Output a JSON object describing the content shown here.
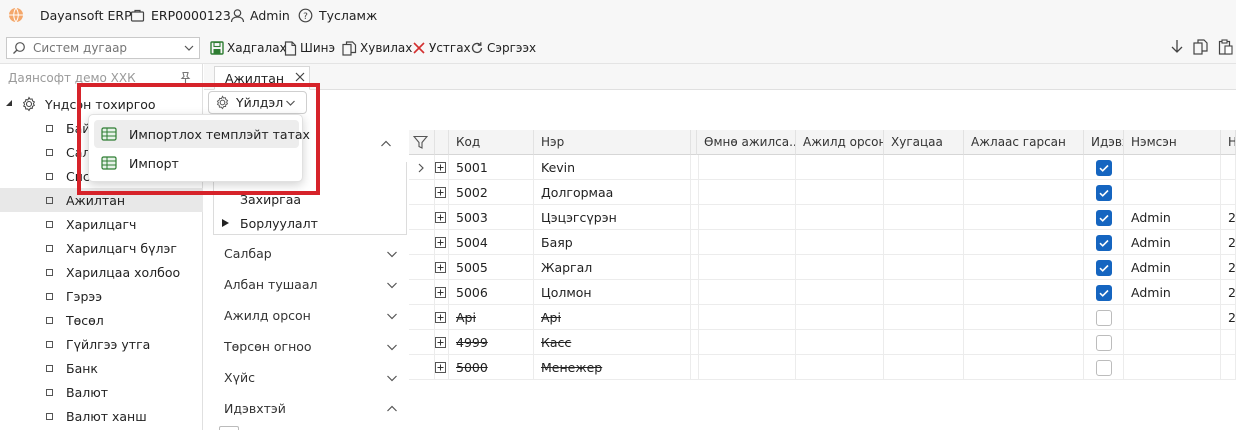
{
  "topbar": {
    "app_name": "Dayansoft ERP",
    "company_code": "ERP0000123",
    "user": "Admin",
    "help": "Тусламж"
  },
  "toolbar": {
    "search_placeholder": "Систем дугаар",
    "save": "Хадгалах",
    "new": "Шинэ",
    "copy": "Хувилах",
    "cancel": "Устгах",
    "refresh": "Сэргээх"
  },
  "left_panel": {
    "company": "Даянсофт демо ХХК",
    "root": "Үндсэн тохиргоо",
    "items": [
      "Байгууллага",
      "Салбар",
      "Систем",
      "Ажилтан",
      "Харилцагч",
      "Харилцагч бүлэг",
      "Харилцаа холбоо",
      "Гэрээ",
      "Төсөл",
      "Гүйлгээ утга",
      "Банк",
      "Валют",
      "Валют ханш"
    ],
    "items_visible": [
      "Байг",
      "Сал",
      "Сист",
      "Ажилтан",
      "Харилцагч",
      "Харилцагч бүлэг",
      "Харилцаа холбоо",
      "Гэрээ",
      "Төсөл",
      "Гүйлгээ утга",
      "Банк",
      "Валют",
      "Валют ханш"
    ],
    "selected_index": 3
  },
  "tabs": [
    {
      "label": "Ажилтан"
    }
  ],
  "actions_button": {
    "label": "Үйлдэл"
  },
  "dropdown_menu": {
    "items": [
      {
        "label": "Импортлох темплэйт татах",
        "icon": "spreadsheet-icon"
      },
      {
        "label": "Импорт",
        "icon": "spreadsheet-icon"
      }
    ]
  },
  "filter_panel": {
    "subitems": [
      "Захиргаа",
      "Борлуулалт"
    ],
    "groups": [
      "Салбар",
      "Албан тушаал",
      "Ажилд орсон",
      "Төрсөн огноо",
      "Хүйс",
      "Идэвхтэй"
    ]
  },
  "grid": {
    "columns": [
      "Код",
      "Нэр",
      "Өмнө ажилса...",
      "Ажилд орсон",
      "Хугацаа",
      "Ажлаас гарсан",
      "Идэвхтэй",
      "Нэмсэн",
      "Н"
    ],
    "rows": [
      {
        "code": "5001",
        "name": "Kevin",
        "active": true,
        "added": "",
        "extra": "",
        "deleted": false
      },
      {
        "code": "5002",
        "name": "Долгормаа",
        "active": true,
        "added": "",
        "extra": "",
        "deleted": false
      },
      {
        "code": "5003",
        "name": "Цэцэгсүрэн",
        "active": true,
        "added": "Admin",
        "extra": "2",
        "deleted": false
      },
      {
        "code": "5004",
        "name": "Баяр",
        "active": true,
        "added": "Admin",
        "extra": "2",
        "deleted": false
      },
      {
        "code": "5005",
        "name": "Жаргал",
        "active": true,
        "added": "Admin",
        "extra": "2",
        "deleted": false
      },
      {
        "code": "5006",
        "name": "Цолмон",
        "active": true,
        "added": "Admin",
        "extra": "2",
        "deleted": false
      },
      {
        "code": "Api",
        "name": "Api",
        "active": false,
        "added": "",
        "extra": "2",
        "deleted": true
      },
      {
        "code": "4999",
        "name": "Касс",
        "active": false,
        "added": "",
        "extra": "",
        "deleted": true
      },
      {
        "code": "5000",
        "name": "Менежер",
        "active": false,
        "added": "",
        "extra": "",
        "deleted": true
      }
    ]
  },
  "colors": {
    "accent": "#1565c0",
    "highlight": "#d6232a",
    "save_green": "#2e7d32",
    "cancel_red": "#d32f2f"
  }
}
